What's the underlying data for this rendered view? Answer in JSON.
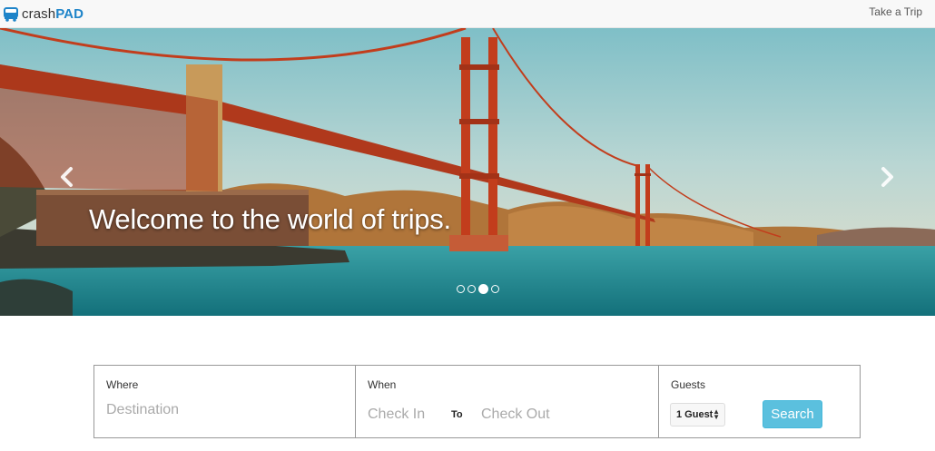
{
  "brand": {
    "name_prefix": "crash",
    "name_suffix": "PAD",
    "icon": "bus-icon",
    "accent_color": "#1e84c9"
  },
  "nav": {
    "take_trip": "Take a Trip"
  },
  "hero": {
    "caption": "Welcome to the world of trips.",
    "prev_icon": "chevron-left-icon",
    "next_icon": "chevron-right-icon",
    "slide_count": 4,
    "active_slide": 3
  },
  "search": {
    "where_label": "Where",
    "destination_placeholder": "Destination",
    "when_label": "When",
    "checkin_placeholder": "Check In",
    "to_label": "To",
    "checkout_placeholder": "Check Out",
    "guests_label": "Guests",
    "guests_value": "1 Guest",
    "search_button": "Search",
    "button_color": "#5bc0de"
  }
}
